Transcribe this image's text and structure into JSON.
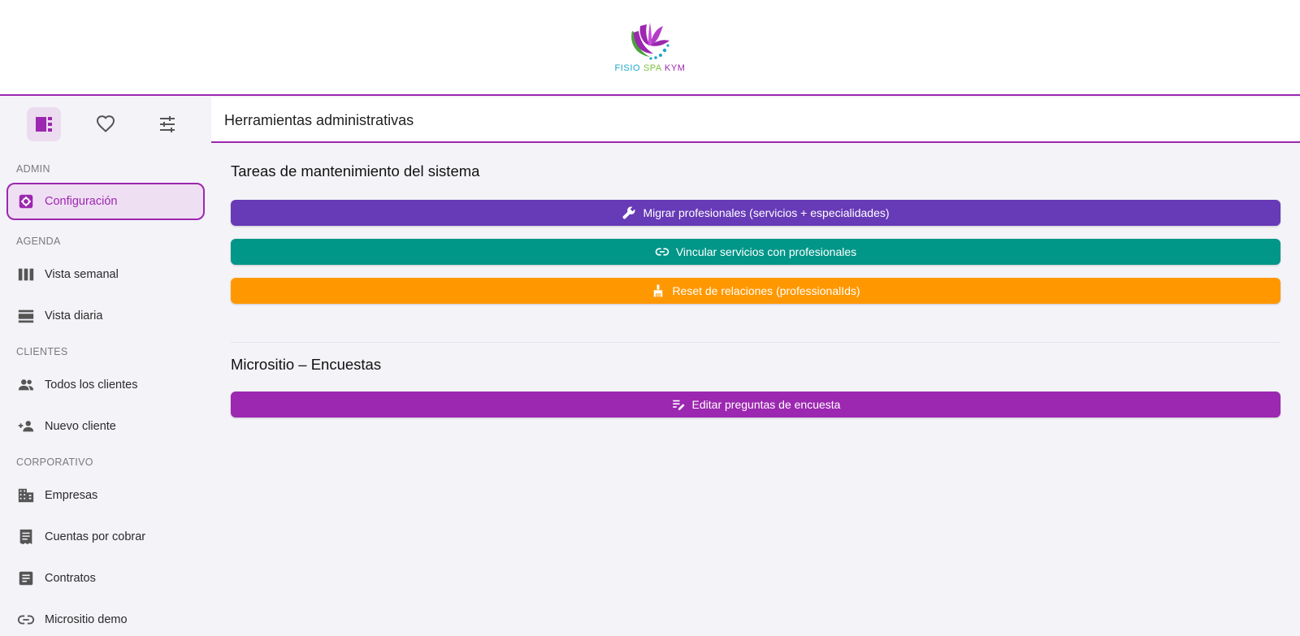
{
  "brand": {
    "words": [
      "FISIO",
      "SPA",
      "KYM"
    ],
    "colors": {
      "fisio": "#1aa7c9",
      "spa": "#7cc242",
      "kym": "#9c27b0"
    }
  },
  "theme": {
    "accent": "#9c27b0",
    "active_bg": "#efdff3"
  },
  "sidebar": {
    "tabs": [
      {
        "icon": "dashboard-icon",
        "active": true
      },
      {
        "icon": "heart-icon",
        "active": false
      },
      {
        "icon": "tune-icon",
        "active": false
      }
    ],
    "sections": [
      {
        "label": "ADMIN",
        "items": [
          {
            "label": "Configuración",
            "icon": "settings-icon",
            "active": true
          }
        ]
      },
      {
        "label": "AGENDA",
        "items": [
          {
            "label": "Vista semanal",
            "icon": "week-view-icon"
          },
          {
            "label": "Vista diaria",
            "icon": "day-view-icon"
          }
        ]
      },
      {
        "label": "CLIENTES",
        "items": [
          {
            "label": "Todos los clientes",
            "icon": "people-icon"
          },
          {
            "label": "Nuevo cliente",
            "icon": "person-add-icon"
          }
        ]
      },
      {
        "label": "CORPORATIVO",
        "items": [
          {
            "label": "Empresas",
            "icon": "building-icon"
          },
          {
            "label": "Cuentas por cobrar",
            "icon": "receipt-icon"
          },
          {
            "label": "Contratos",
            "icon": "document-icon"
          },
          {
            "label": "Micrositio demo",
            "icon": "link-icon"
          }
        ]
      }
    ]
  },
  "header": {
    "title": "Herramientas administrativas"
  },
  "maintenance": {
    "title": "Tareas de mantenimiento del sistema",
    "buttons": [
      {
        "label": "Migrar profesionales (servicios + especialidades)",
        "icon": "wrench-icon",
        "color": "#673ab7"
      },
      {
        "label": "Vincular servicios con profesionales",
        "icon": "link-icon",
        "color": "#009688"
      },
      {
        "label": "Reset de relaciones (professionalIds)",
        "icon": "broom-icon",
        "color": "#ff9800"
      }
    ]
  },
  "survey": {
    "title": "Micrositio – Encuestas",
    "buttons": [
      {
        "label": "Editar preguntas de encuesta",
        "icon": "edit-note-icon",
        "color": "#9c27b0"
      }
    ]
  }
}
